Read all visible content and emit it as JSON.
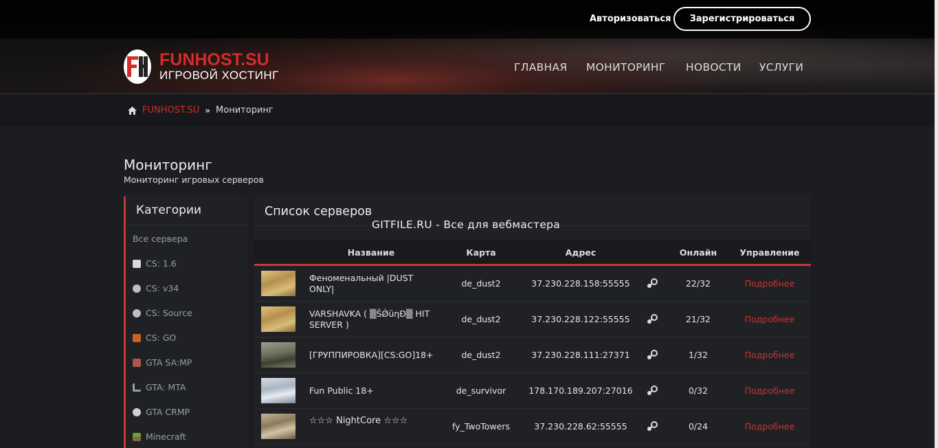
{
  "header": {
    "login_label": "Авторизоваться",
    "register_label": "Зарегистрироваться",
    "logo_name": "FUNHOST.SU",
    "logo_sub": "ИГРОВОЙ ХОСТИНГ",
    "nav": [
      "ГЛАВНАЯ",
      "МОНИТОРИНГ",
      "НОВОСТИ",
      "УСЛУГИ"
    ]
  },
  "breadcrumb": {
    "home": "FUNHOST.SU",
    "current": "Мониторинг"
  },
  "page": {
    "title": "Мониторинг",
    "subtitle": "Мониторинг игровых серверов"
  },
  "sidebar": {
    "title": "Категории",
    "items": [
      {
        "label": "Все сервера",
        "icon": ""
      },
      {
        "label": "CS: 1.6",
        "icon": "cs16-icon"
      },
      {
        "label": "CS: v34",
        "icon": "csv34-icon"
      },
      {
        "label": "CS: Source",
        "icon": "cssource-icon"
      },
      {
        "label": "CS: GO",
        "icon": "csgo-icon"
      },
      {
        "label": "GTA SA:MP",
        "icon": "samp-icon"
      },
      {
        "label": "GTA: MTA",
        "icon": "mta-icon"
      },
      {
        "label": "GTA CRMP",
        "icon": "crmp-icon"
      },
      {
        "label": "Minecraft",
        "icon": "minecraft-icon"
      }
    ]
  },
  "servers": {
    "title": "Список серверов",
    "columns": [
      "Название",
      "Карта",
      "Адрес",
      "Онлайн",
      "Управление"
    ],
    "rows": [
      {
        "name": "Феноменальный |DUST ONLY|",
        "map": "de_dust2",
        "address": "37.230.228.158:55555",
        "online": "22/32",
        "action": "Подробнее"
      },
      {
        "name": "VARSHAVKA ( ▒ŠǾüηĐ▒ HIT SERVER )",
        "map": "de_dust2",
        "address": "37.230.228.122:55555",
        "online": "21/32",
        "action": "Подробнее"
      },
      {
        "name": "[ГРУППИРОВКА][CS:GO]18+",
        "map": "de_dust2",
        "address": "37.230.228.111:27371",
        "online": "1/32",
        "action": "Подробнее"
      },
      {
        "name": "Fun Public 18+",
        "map": "de_survivor",
        "address": "178.170.189.207:27016",
        "online": "0/32",
        "action": "Подробнее"
      },
      {
        "name": "☆☆☆ NightCore ☆☆☆",
        "map": "fy_TwoTowers",
        "address": "37.230.228.62:55555",
        "online": "0/24",
        "action": "Подробнее"
      }
    ]
  },
  "watermark": "GITFILE.RU - Все для вебмастера",
  "colors": {
    "accent": "#d32c2a",
    "background": "#1b1d21",
    "panel": "#1f2125"
  }
}
